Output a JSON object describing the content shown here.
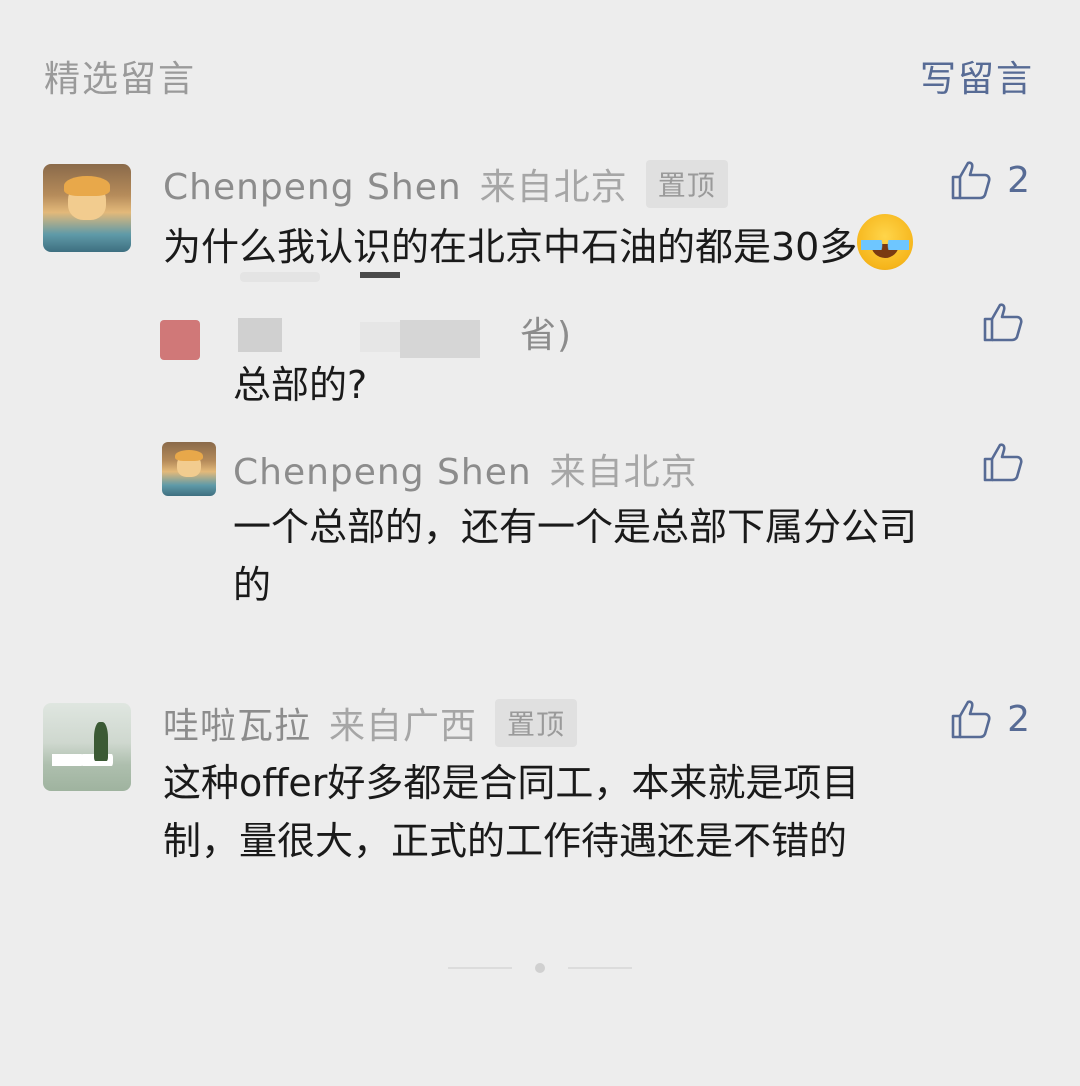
{
  "header": {
    "title": "精选留言",
    "write_label": "写留言"
  },
  "comments": [
    {
      "name": "Chenpeng Shen",
      "location": "来自北京",
      "pinned_label": "置顶",
      "likes": "2",
      "text": "为什么我认识的在北京中石油的都是30多",
      "emoji": "laughing-tears-emoji",
      "replies": [
        {
          "name_fragment": "省)",
          "text": "总部的?"
        },
        {
          "name": "Chenpeng Shen",
          "location": "来自北京",
          "text_line1": "一个总部的，还有一个是总部下属分公司",
          "text_line2": "的"
        }
      ]
    },
    {
      "name": "哇啦瓦拉",
      "location": "来自广西",
      "pinned_label": "置顶",
      "likes": "2",
      "text_line1": "这种offer好多都是合同工，本来就是项目",
      "text_line2": "制，量很大，正式的工作待遇还是不错的"
    }
  ],
  "colors": {
    "background": "#ededed",
    "link": "#576b95",
    "muted": "#9a9a9a",
    "text": "#1a1a1a"
  }
}
